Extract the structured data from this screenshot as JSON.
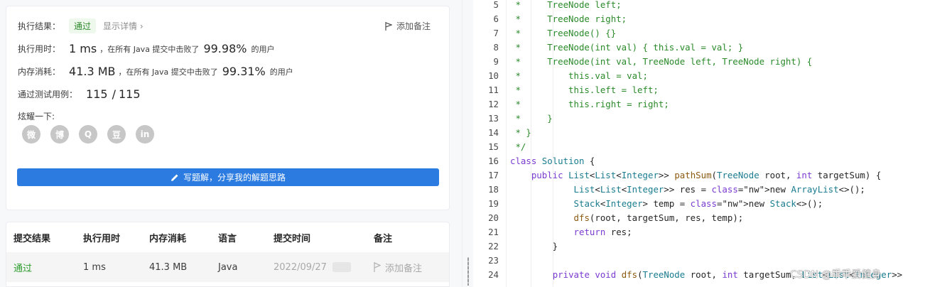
{
  "result": {
    "status_label": "执行结果：",
    "status_badge": "通过",
    "detail_link": "显示详情 ›",
    "add_note": "添加备注",
    "runtime_label": "执行用时：",
    "runtime_value": "1 ms",
    "runtime_text": "，在所有 Java 提交中击败了",
    "runtime_pct": "99.98%",
    "runtime_suffix": "的用户",
    "memory_label": "内存消耗：",
    "memory_value": "41.3 MB",
    "memory_text": "，在所有 Java 提交中击败了",
    "memory_pct": "99.31%",
    "memory_suffix": "的用户",
    "tests_label": "通过测试用例：",
    "tests_passed": "115",
    "tests_sep": "/",
    "tests_total": "115",
    "share_label": "炫耀一下:",
    "social": [
      {
        "icon": "wechat-icon",
        "glyph": "微"
      },
      {
        "icon": "weibo-icon",
        "glyph": "博"
      },
      {
        "icon": "qq-icon",
        "glyph": "Q"
      },
      {
        "icon": "douban-icon",
        "glyph": "豆"
      },
      {
        "icon": "linkedin-icon",
        "glyph": "in"
      }
    ],
    "write_button": "写题解，分享我的解题思路"
  },
  "table": {
    "headers": [
      "提交结果",
      "执行用时",
      "内存消耗",
      "语言",
      "提交时间",
      "备注"
    ],
    "rows": [
      {
        "result": "通过",
        "time": "1 ms",
        "memory": "41.3 MB",
        "lang": "Java",
        "date": "2022/09/27",
        "note": "添加备注"
      }
    ]
  },
  "code": {
    "lines": [
      {
        "n": "5",
        "text": " *     TreeNode left;"
      },
      {
        "n": "6",
        "text": " *     TreeNode right;"
      },
      {
        "n": "7",
        "text": " *     TreeNode() {}"
      },
      {
        "n": "8",
        "text": " *     TreeNode(int val) { this.val = val; }"
      },
      {
        "n": "9",
        "text": " *     TreeNode(int val, TreeNode left, TreeNode right) {"
      },
      {
        "n": "10",
        "text": " *         this.val = val;"
      },
      {
        "n": "11",
        "text": " *         this.left = left;"
      },
      {
        "n": "12",
        "text": " *         this.right = right;"
      },
      {
        "n": "13",
        "text": " *     }"
      },
      {
        "n": "14",
        "text": " * }"
      },
      {
        "n": "15",
        "text": " */"
      },
      {
        "n": "16",
        "text": "class Solution {"
      },
      {
        "n": "17",
        "text": "    public List<List<Integer>> pathSum(TreeNode root, int targetSum) {"
      },
      {
        "n": "18",
        "text": "            List<List<Integer>> res = new ArrayList<>();"
      },
      {
        "n": "19",
        "text": "            Stack<Integer> temp = new Stack<>();"
      },
      {
        "n": "20",
        "text": "            dfs(root, targetSum, res, temp);"
      },
      {
        "n": "21",
        "text": "            return res;"
      },
      {
        "n": "22",
        "text": "        }"
      },
      {
        "n": "23",
        "text": ""
      },
      {
        "n": "24",
        "text": "        private void dfs(TreeNode root, int targetSum, List<List<Integer>>"
      }
    ],
    "watermark": "CSDN @乖乖爱健身"
  }
}
